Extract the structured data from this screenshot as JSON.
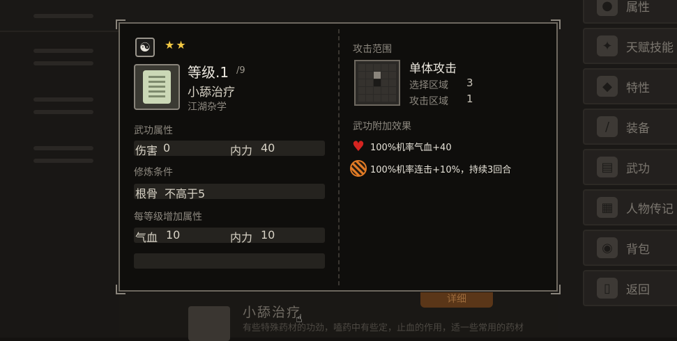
{
  "side_menu": {
    "items": [
      {
        "label": "属性",
        "icon": "person-icon"
      },
      {
        "label": "天赋技能",
        "icon": "talent-icon"
      },
      {
        "label": "特性",
        "icon": "trait-icon"
      },
      {
        "label": "装备",
        "icon": "sword-icon"
      },
      {
        "label": "武功",
        "icon": "scroll-icon"
      },
      {
        "label": "人物传记",
        "icon": "book-icon"
      },
      {
        "label": "背包",
        "icon": "bag-icon"
      },
      {
        "label": "返回",
        "icon": "door-icon"
      }
    ]
  },
  "background_item": {
    "title": "小舔治疗",
    "desc": "有些特殊药材的功劲，嗑药中有些定，止血的作用，适一些常用的药材",
    "detail_button": "详细"
  },
  "skill": {
    "stars": "★★",
    "level": "等级.1",
    "level_max": "/9",
    "name": "小舔治疗",
    "school": "江湖杂学",
    "attributes_title": "武功属性",
    "damage_label": "伤害",
    "damage_value": "0",
    "inner_label": "内力",
    "inner_value": "40",
    "requirement_title": "修炼条件",
    "req_label": "根骨",
    "req_value": "不高于5",
    "per_level_title": "每等级增加属性",
    "hp_label": "气血",
    "hp_value": "10",
    "per_inner_label": "内力",
    "per_inner_value": "10"
  },
  "attack": {
    "range_title": "攻击范围",
    "type": "单体攻击",
    "select_label": "选择区域",
    "select_value": "3",
    "attack_label": "攻击区域",
    "attack_value": "1",
    "effects_title": "武功附加效果",
    "effects": [
      {
        "icon": "heart-icon",
        "text": "100%机率气血+40"
      },
      {
        "icon": "combo-icon",
        "text": "100%机率连击+10%，持续3回合"
      }
    ]
  },
  "colors": {
    "requirement_red": "#e2261b",
    "star_gold": "#f2c843",
    "heart_red": "#d52420",
    "combo_orange": "#e07a25"
  }
}
